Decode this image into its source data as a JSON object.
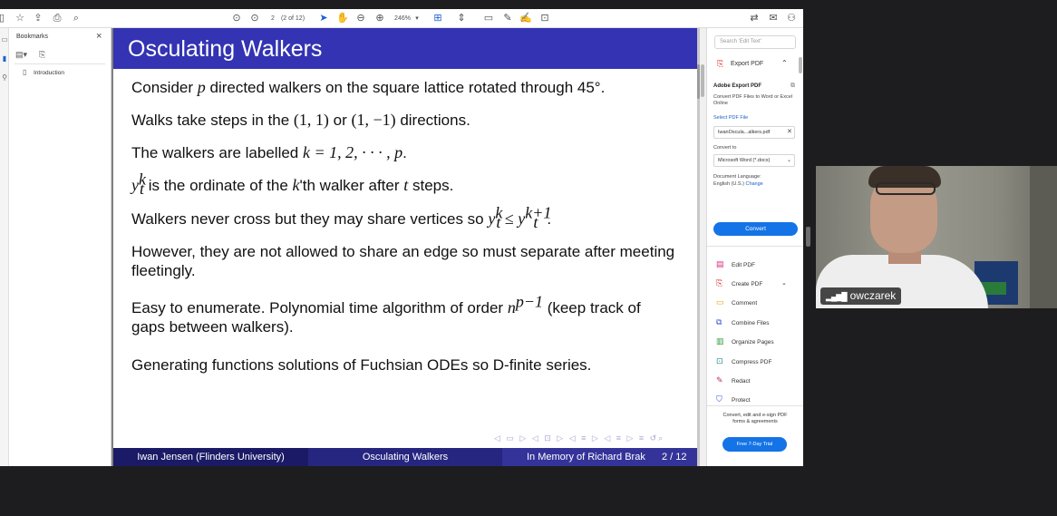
{
  "toolbar": {
    "page_current": "2",
    "page_of": "(2 of 12)",
    "zoom": "246%",
    "icons": [
      "bookmark-icon",
      "star-icon",
      "upload-icon",
      "print-icon",
      "search-icon",
      "prev-page-icon",
      "next-page-icon",
      "select-cursor-icon",
      "hand-icon",
      "zoom-out-icon",
      "zoom-in-icon",
      "fit-page-icon",
      "scroll-mode-icon",
      "comment-icon",
      "pen-icon",
      "sign-icon",
      "stamp-icon",
      "share-icon",
      "mail-icon",
      "user-icon"
    ]
  },
  "bookmarks": {
    "title": "Bookmarks",
    "items": [
      {
        "label": "Introduction"
      }
    ]
  },
  "slide": {
    "title": "Osculating Walkers",
    "bullets": {
      "b1_pre": "Consider ",
      "b1_p": "p",
      "b1_post": " directed walkers on the square lattice rotated through 45°.",
      "b2_pre": "Walks take steps in the ",
      "b2_a": "(1, 1)",
      "b2_mid": " or ",
      "b2_b": "(1, −1)",
      "b2_post": " directions.",
      "b3_pre": "The walkers are labelled ",
      "b3_math": "k = 1, 2, · · · , p",
      "b3_post": ".",
      "b4_y": "y",
      "b4_sup": "k",
      "b4_sub": "t",
      "b4_pre": " is the ordinate of the ",
      "b4_k": "k",
      "b4_mid": "'th walker after ",
      "b4_t": "t",
      "b4_post": " steps.",
      "b5_pre": "Walkers never cross but they may share vertices so ",
      "b5_y1": "y",
      "b5_sup1": "k",
      "b5_sub1": "t",
      "b5_le": " ≤ ",
      "b5_y2": "y",
      "b5_sup2": "k+1",
      "b5_sub2": "t",
      "b5_post": ".",
      "b6": "However, they are not allowed to share an edge so must separate after meeting fleetingly.",
      "b7_pre": "Easy to enumerate. Polynomial time algorithm of order ",
      "b7_n": "n",
      "b7_sup": "p−1",
      "b7_post": " (keep track of gaps between walkers).",
      "b8": "Generating functions solutions of Fuchsian ODEs so D-finite series."
    },
    "footer": {
      "author": "Iwan Jensen  (Flinders University)",
      "short_title": "Osculating Walkers",
      "event": "In Memory of Richard Brak",
      "page": "2 / 12"
    }
  },
  "rightpanel": {
    "search_placeholder": "Search 'Edit Text'",
    "export_header": "Export PDF",
    "adobe_export_title": "Adobe Export PDF",
    "description": "Convert PDF Files to Word or Excel Online",
    "select_file": "Select PDF File",
    "file_name": "IwanOscula...alkers.pdf",
    "convert_to": "Convert to",
    "format": "Microsoft Word (*.docx)",
    "doc_language": "Document Language:",
    "language": "English (U.S.)",
    "change": "Change",
    "convert_button": "Convert",
    "tools": [
      {
        "label": "Edit PDF",
        "color": "#d9287a"
      },
      {
        "label": "Create PDF",
        "color": "#d22a2a"
      },
      {
        "label": "Comment",
        "color": "#e0a800"
      },
      {
        "label": "Combine Files",
        "color": "#3a4fd0"
      },
      {
        "label": "Organize Pages",
        "color": "#2e9a3a"
      },
      {
        "label": "Compress PDF",
        "color": "#2a8a8a"
      },
      {
        "label": "Redact",
        "color": "#c22a6a"
      },
      {
        "label": "Protect",
        "color": "#3a4fd0"
      }
    ],
    "esign_text": "Convert, edit and e-sign PDF forms & agreements",
    "trial_button": "Free 7-Day Trial"
  },
  "video": {
    "participant_name": "owczarek"
  }
}
